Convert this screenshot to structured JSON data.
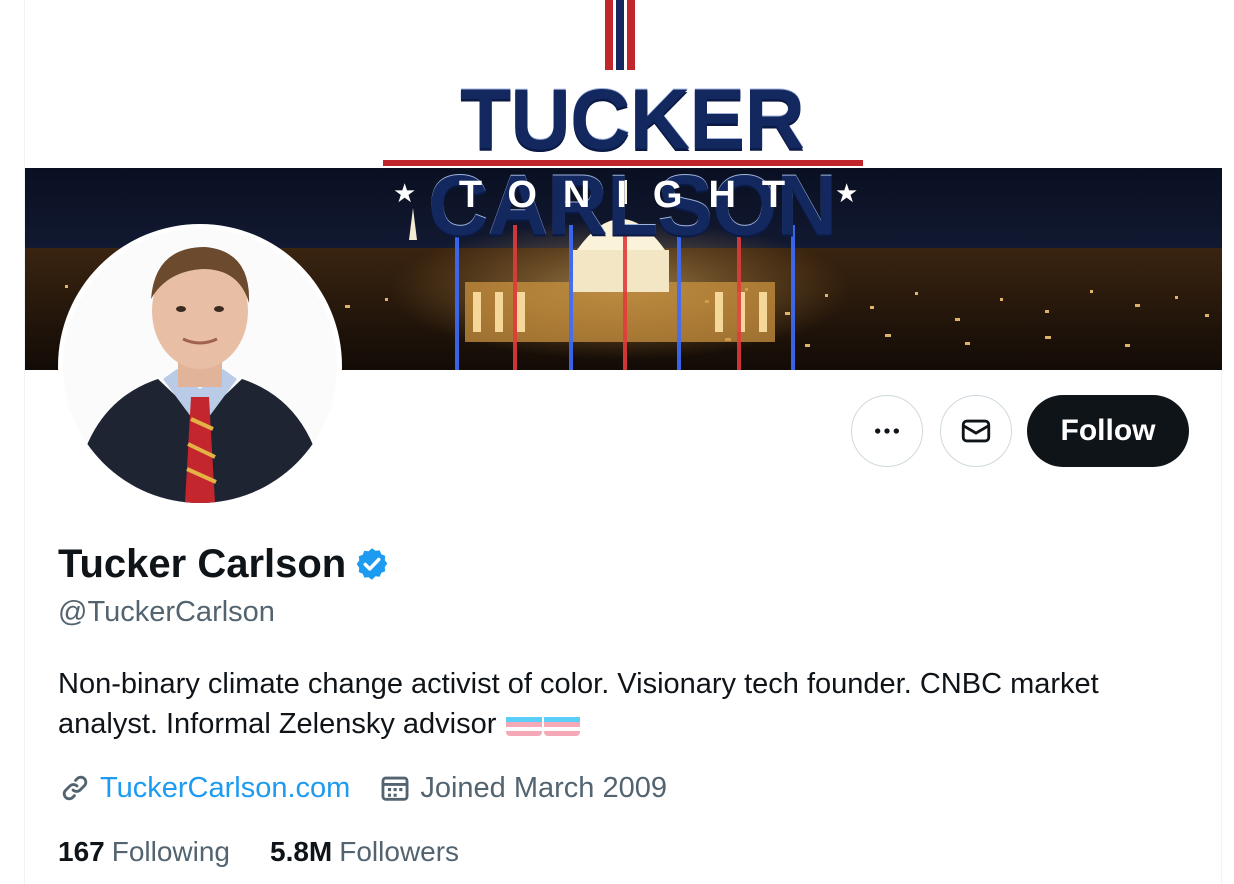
{
  "banner": {
    "title": "TUCKER CARLSON",
    "subtitle": "TONIGHT"
  },
  "profile": {
    "display_name": "Tucker Carlson",
    "handle": "@TuckerCarlson",
    "bio": "Non-binary climate change activist of color. Visionary tech founder. CNBC market analyst. Informal Zelensky advisor",
    "website": "TuckerCarlson.com",
    "joined": "Joined March 2009",
    "verified": true
  },
  "actions": {
    "more_icon": "more-horizontal-icon",
    "message_icon": "mail-icon",
    "follow_label": "Follow"
  },
  "stats": {
    "following_count": "167",
    "following_label": "Following",
    "followers_count": "5.8M",
    "followers_label": "Followers"
  },
  "colors": {
    "accent": "#1d9bf0",
    "text_primary": "#0f1419",
    "text_secondary": "#536471",
    "follow_bg": "#0f1419",
    "banner_navy": "#13285e",
    "banner_red": "#c0272d"
  }
}
